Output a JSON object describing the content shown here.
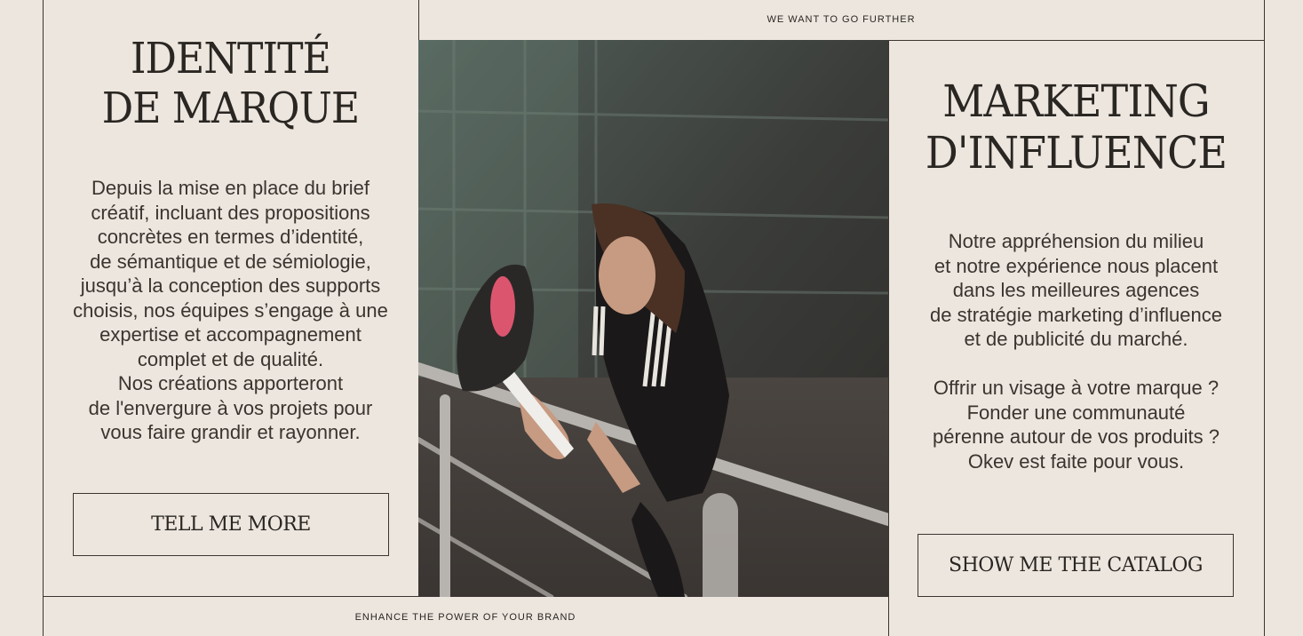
{
  "taglines": {
    "top": "WE WANT TO GO FURTHER",
    "bottom": "ENHANCE THE POWER OF YOUR BRAND"
  },
  "left": {
    "title": "IDENTITÉ\nDE MARQUE",
    "body": "Depuis la mise en place du brief\ncréatif, incluant des propositions\nconcrètes en termes d’identité,\nde sémantique et de sémiologie,\njusqu’à la conception des supports\nchoisis, nos équipes s’engage à une\nexpertise et accompagnement\ncomplet et de qualité.\nNos créations apporteront\nde l'envergure à vos projets pour\nvous faire grandir et rayonner.",
    "button": "TELL ME MORE"
  },
  "right": {
    "title": "MARKETING\nD'INFLUENCE",
    "body": "Notre appréhension du milieu\net notre expérience nous placent\ndans les meilleures agences\nde stratégie marketing d’influence\net de publicité du marché.\n\nOffrir un visage à votre marque ?\nFonder une communauté\npérenne autour de vos produits ?\nOkev est faite pour vous.",
    "button": "SHOW ME THE CATALOG"
  },
  "photo": {
    "subject": "athlete stretching leg on railing"
  },
  "colors": {
    "background": "#ede6df",
    "ink": "#2a2622",
    "line": "#3a3530"
  }
}
